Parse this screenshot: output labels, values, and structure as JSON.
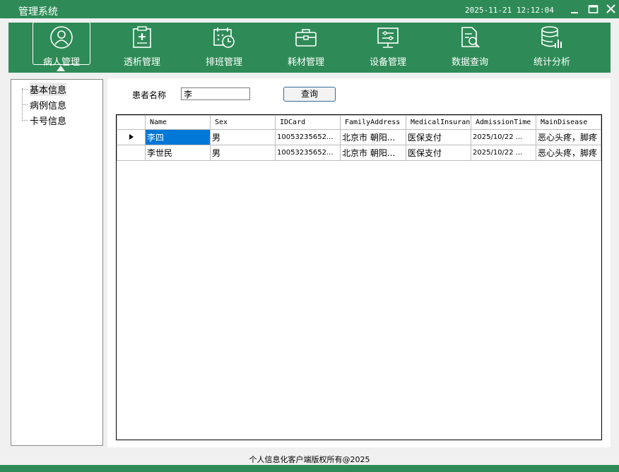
{
  "window": {
    "title": "管理系统",
    "clock": "2025-11-21 12:12:04"
  },
  "toolbar": {
    "items": [
      {
        "label": "病人管理",
        "icon": "user-icon",
        "active": true
      },
      {
        "label": "透析管理",
        "icon": "clipboard-plus-icon"
      },
      {
        "label": "排班管理",
        "icon": "calendar-clock-icon"
      },
      {
        "label": "耗材管理",
        "icon": "toolbox-icon"
      },
      {
        "label": "设备管理",
        "icon": "monitor-settings-icon"
      },
      {
        "label": "数据查询",
        "icon": "document-search-icon"
      },
      {
        "label": "统计分析",
        "icon": "database-chart-icon"
      }
    ]
  },
  "tree": {
    "items": [
      "基本信息",
      "病例信息",
      "卡号信息"
    ]
  },
  "search": {
    "label": "患者名称",
    "value": "李",
    "button": "查询"
  },
  "grid": {
    "columns": [
      "Name",
      "Sex",
      "IDCard",
      "FamilyAddress",
      "MedicalInsuran",
      "AdmissionTime",
      "MainDisease"
    ],
    "rows": [
      [
        "李四",
        "男",
        "10053235652...",
        "北京市 朝阳...",
        "医保支付",
        "2025/10/22 ...",
        "恶心头疼，脚疼"
      ],
      [
        "李世民",
        "男",
        "10053235652...",
        "北京市 朝阳...",
        "医保支付",
        "2025/10/22 ...",
        "恶心头疼，脚疼"
      ]
    ]
  },
  "footer": {
    "copyright": "个人信息化客户端版权所有@2025"
  },
  "colors": {
    "brand": "#2e8b57",
    "selection": "#0078d7"
  }
}
